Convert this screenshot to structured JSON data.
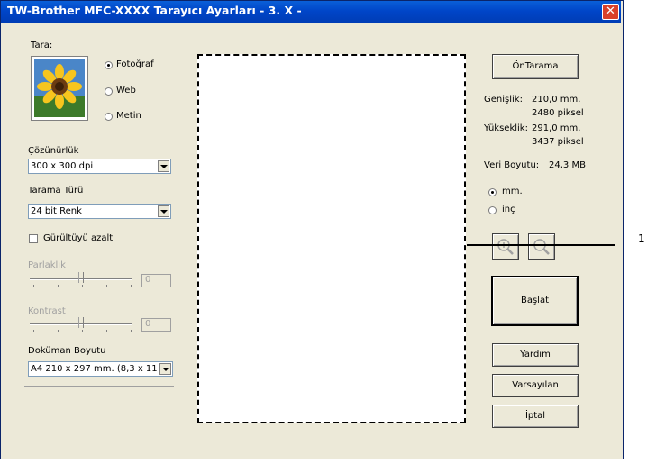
{
  "window": {
    "title": "TW-Brother MFC-XXXX    Tarayıcı Ayarları - 3. X -",
    "close_icon": "close-icon"
  },
  "scan": {
    "label": "Tara:",
    "options": [
      "Fotoğraf",
      "Web",
      "Metin"
    ],
    "selected": "Fotoğraf"
  },
  "resolution": {
    "label": "Çözünürlük",
    "value": "300 x 300 dpi"
  },
  "scan_type": {
    "label": "Tarama Türü",
    "value": "24 bit Renk"
  },
  "noise": {
    "label": "Gürültüyü azalt",
    "checked": false
  },
  "brightness": {
    "label": "Parlaklık",
    "value": "0",
    "level": 0.5
  },
  "contrast": {
    "label": "Kontrast",
    "value": "0",
    "level": 0.5
  },
  "doc_size": {
    "label": "Doküman Boyutu",
    "value": "A4 210 x 297 mm. (8,3 x 11"
  },
  "info": {
    "width_label": "Genişlik:",
    "width_mm": "210,0 mm.",
    "width_px": "2480 piksel",
    "height_label": "Yükseklik:",
    "height_mm": "291,0 mm.",
    "height_px": "3437 piksel",
    "data_size_label": "Veri Boyutu:",
    "data_size_value": "24,3 MB"
  },
  "units": {
    "options": [
      "mm.",
      "inç"
    ],
    "selected": "mm."
  },
  "buttons": {
    "prescan": "ÖnTarama",
    "start": "Başlat",
    "help": "Yardım",
    "defaults": "Varsayılan",
    "cancel": "İptal"
  },
  "callout": "1",
  "colors": {
    "titlebar": "#0054e3",
    "dialog_bg": "#ece9d8",
    "close": "#d9402a"
  }
}
